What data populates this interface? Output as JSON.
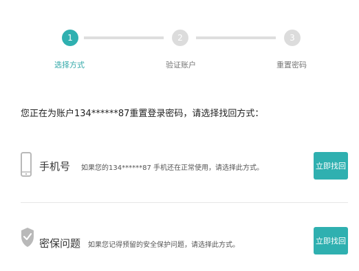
{
  "colors": {
    "accent": "#2fb0b0",
    "inactive": "#dcdcdc",
    "step_label_active": "#2fa7a7",
    "step_label_inactive": "#777777"
  },
  "steps": [
    {
      "number": "1",
      "label": "选择方式",
      "state": "active"
    },
    {
      "number": "2",
      "label": "验证账户",
      "state": "inactive"
    },
    {
      "number": "3",
      "label": "重置密码",
      "state": "inactive"
    }
  ],
  "intro": {
    "text": "您正在为账户134******87重置登录密码，请选择找回方式："
  },
  "options": [
    {
      "icon": "phone-icon",
      "title": "手机号",
      "description": "如果您的134******87 手机还在正常使用，请选择此方式。",
      "button": "立即找回"
    },
    {
      "icon": "shield-check-icon",
      "title": "密保问题",
      "description": "如果您记得预留的安全保护问题，请选择此方式。",
      "button": "立即找回"
    }
  ]
}
